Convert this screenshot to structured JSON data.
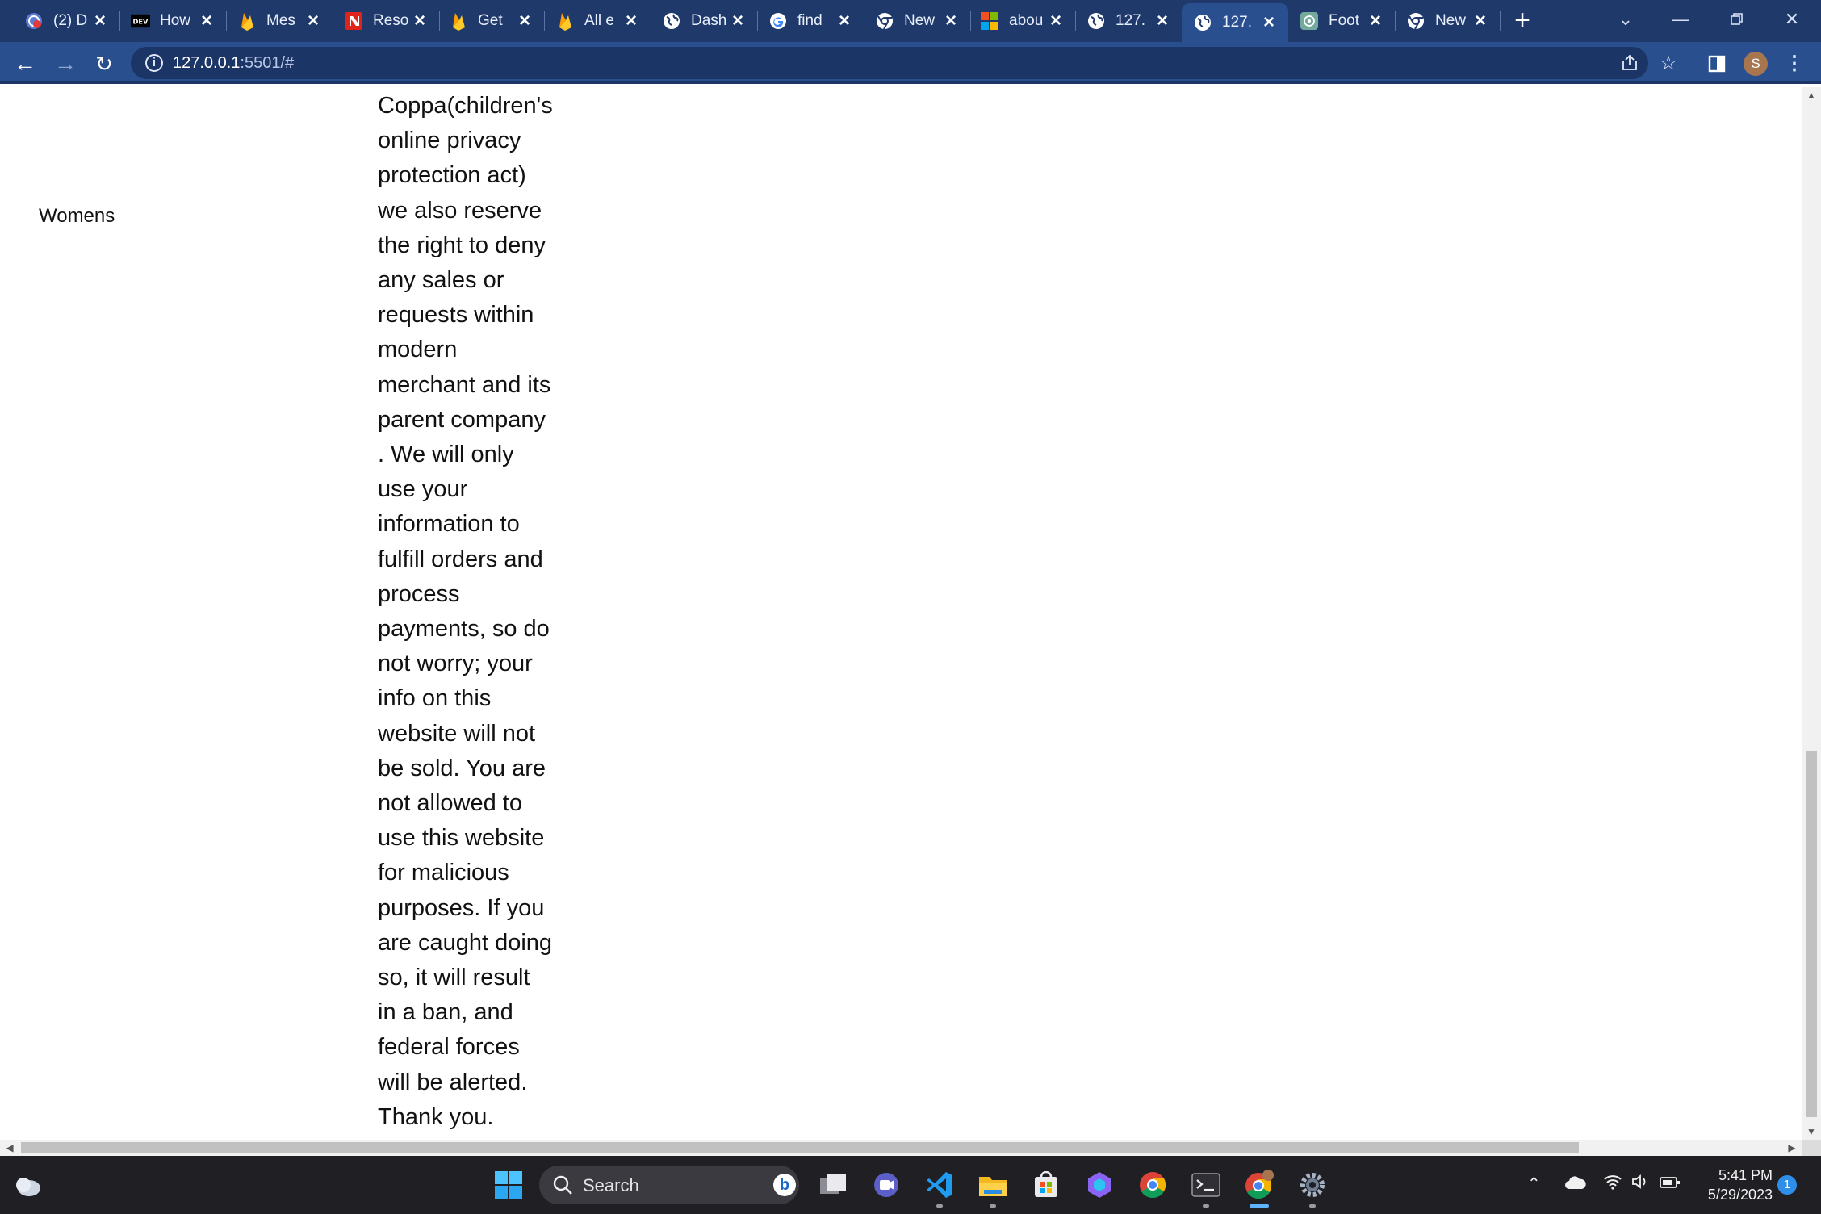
{
  "browser": {
    "tabs": [
      {
        "label": "(2) D",
        "icon": "rmail-icon"
      },
      {
        "label": "How",
        "icon": "dev-icon"
      },
      {
        "label": "Mes",
        "icon": "firebase-icon"
      },
      {
        "label": "Reso",
        "icon": "notion-icon"
      },
      {
        "label": "Get",
        "icon": "firebase-icon"
      },
      {
        "label": "All e",
        "icon": "firebase-icon"
      },
      {
        "label": "Dash",
        "icon": "globe-icon"
      },
      {
        "label": "find",
        "icon": "google-icon"
      },
      {
        "label": "New",
        "icon": "chrome-icon"
      },
      {
        "label": "abou",
        "icon": "microsoft-icon"
      },
      {
        "label": "127.",
        "icon": "globe-icon"
      },
      {
        "label": "127.",
        "icon": "globe-icon",
        "active": true
      },
      {
        "label": "Foot",
        "icon": "openai-icon"
      },
      {
        "label": "New",
        "icon": "chrome-icon"
      }
    ],
    "address": {
      "host": "127.0.0.1",
      "rest": ":5501/#"
    },
    "profile_initial": "S",
    "accent": "#2a4f8f"
  },
  "page": {
    "sidebar_label": "Womens",
    "policy_lines": [
      "Coppa(children's",
      "online privacy",
      "protection act)",
      "we also reserve",
      "the right to deny",
      "any sales or",
      "requests within",
      "modern",
      "merchant and its",
      "parent company",
      ". We will only",
      "use your",
      "information to",
      "fulfill orders and",
      "process",
      "payments, so do",
      "not worry; your",
      "info on this",
      "website will not",
      "be sold. You are",
      "not allowed to",
      "use this website",
      "for malicious",
      "purposes. If you",
      "are caught doing",
      "so, it will result",
      "in a ban, and",
      "federal forces",
      "will be alerted.",
      "Thank you."
    ]
  },
  "taskbar": {
    "search_placeholder": "Search",
    "time": "5:41 PM",
    "date": "5/29/2023",
    "notification_count": "1"
  }
}
